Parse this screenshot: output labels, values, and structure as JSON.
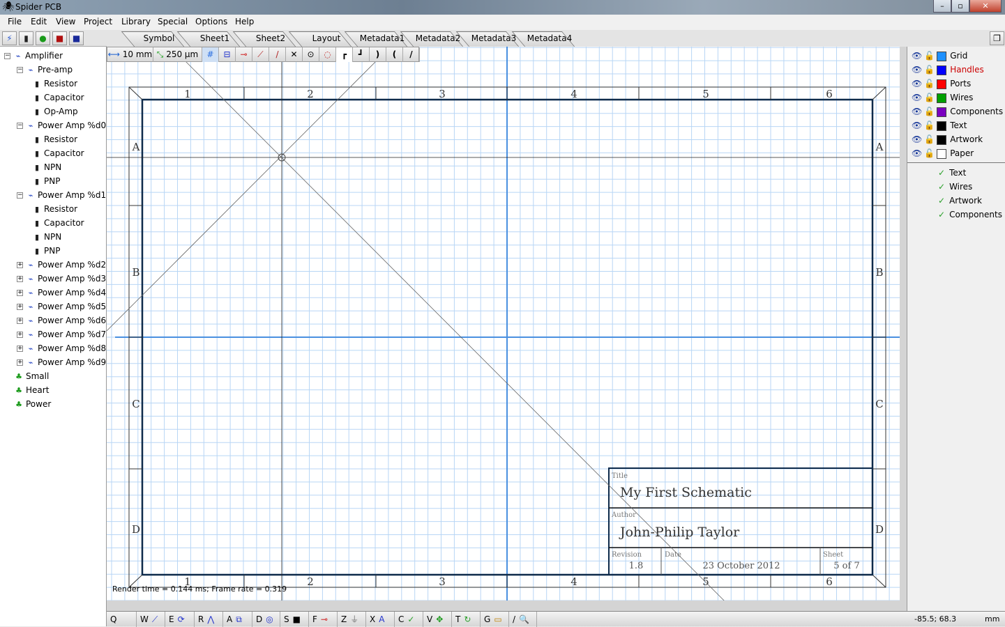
{
  "window": {
    "title": "Spider PCB",
    "minimize": "–",
    "maximize": "▫",
    "close": "✕"
  },
  "menu": [
    "File",
    "Edit",
    "View",
    "Project",
    "Library",
    "Special",
    "Options",
    "Help"
  ],
  "main_toolbar": [
    {
      "icon": "new-project-icon",
      "glyph": "⚡"
    },
    {
      "icon": "component-icon",
      "glyph": "▮"
    },
    {
      "icon": "add-icon",
      "glyph": "●"
    },
    {
      "icon": "save-icon",
      "glyph": "■"
    },
    {
      "icon": "save-all-icon",
      "glyph": "■"
    }
  ],
  "tabs": [
    "Symbol",
    "Sheet1",
    "Sheet2",
    "Layout",
    "Metadata1",
    "Metadata2",
    "Metadata3",
    "Metadata4"
  ],
  "draw_toolbar": {
    "grid_size": "10 mm",
    "line_width": "250 µm"
  },
  "tree": [
    {
      "label": "Amplifier",
      "level": 0,
      "type": "schematic",
      "exp": "−"
    },
    {
      "label": "Pre-amp",
      "level": 1,
      "type": "schematic",
      "exp": "−"
    },
    {
      "label": "Resistor",
      "level": 2,
      "type": "component"
    },
    {
      "label": "Capacitor",
      "level": 2,
      "type": "component"
    },
    {
      "label": "Op-Amp",
      "level": 2,
      "type": "component"
    },
    {
      "label": "Power Amp %d0",
      "level": 1,
      "type": "schematic",
      "exp": "−"
    },
    {
      "label": "Resistor",
      "level": 2,
      "type": "component"
    },
    {
      "label": "Capacitor",
      "level": 2,
      "type": "component"
    },
    {
      "label": "NPN",
      "level": 2,
      "type": "component"
    },
    {
      "label": "PNP",
      "level": 2,
      "type": "component"
    },
    {
      "label": "Power Amp %d1",
      "level": 1,
      "type": "schematic",
      "exp": "−"
    },
    {
      "label": "Resistor",
      "level": 2,
      "type": "component"
    },
    {
      "label": "Capacitor",
      "level": 2,
      "type": "component"
    },
    {
      "label": "NPN",
      "level": 2,
      "type": "component"
    },
    {
      "label": "PNP",
      "level": 2,
      "type": "component"
    },
    {
      "label": "Power Amp %d2",
      "level": 1,
      "type": "schematic",
      "exp": "+"
    },
    {
      "label": "Power Amp %d3",
      "level": 1,
      "type": "schematic",
      "exp": "+"
    },
    {
      "label": "Power Amp %d4",
      "level": 1,
      "type": "schematic",
      "exp": "+"
    },
    {
      "label": "Power Amp %d5",
      "level": 1,
      "type": "schematic",
      "exp": "+"
    },
    {
      "label": "Power Amp %d6",
      "level": 1,
      "type": "schematic",
      "exp": "+"
    },
    {
      "label": "Power Amp %d7",
      "level": 1,
      "type": "schematic",
      "exp": "+"
    },
    {
      "label": "Power Amp %d8",
      "level": 1,
      "type": "schematic",
      "exp": "+"
    },
    {
      "label": "Power Amp %d9",
      "level": 1,
      "type": "schematic",
      "exp": "+"
    },
    {
      "label": "Small",
      "level": 0,
      "type": "project"
    },
    {
      "label": "Heart",
      "level": 0,
      "type": "project"
    },
    {
      "label": "Power",
      "level": 0,
      "type": "project"
    }
  ],
  "layers": [
    {
      "name": "Grid",
      "color": "#1e90ff",
      "visible": true,
      "locked": false
    },
    {
      "name": "Handles",
      "color": "#0000ff",
      "visible": true,
      "locked": false,
      "highlight": "#cc0000"
    },
    {
      "name": "Ports",
      "color": "#ff0000",
      "visible": true,
      "locked": false
    },
    {
      "name": "Wires",
      "color": "#00a000",
      "visible": true,
      "locked": false
    },
    {
      "name": "Components",
      "color": "#7a00c0",
      "visible": true,
      "locked": false
    },
    {
      "name": "Text",
      "color": "#000000",
      "visible": true,
      "locked": false
    },
    {
      "name": "Artwork",
      "color": "#000000",
      "visible": true,
      "locked": false
    },
    {
      "name": "Paper",
      "color": "#ffffff",
      "visible": true,
      "locked": false
    }
  ],
  "checks": [
    "Text",
    "Wires",
    "Artwork",
    "Components"
  ],
  "sheet": {
    "columns": [
      "1",
      "2",
      "3",
      "4",
      "5",
      "6"
    ],
    "rows": [
      "A",
      "B",
      "C",
      "D"
    ],
    "title_label": "Title",
    "title": "My First Schematic",
    "author_label": "Author",
    "author": "John-Philip Taylor",
    "revision_label": "Revision",
    "revision": "1.8",
    "date_label": "Date",
    "date": "23 October 2012",
    "sheet_label": "Sheet",
    "sheet": "5 of 7"
  },
  "render_info": "Render time = 0.144 ms; Frame rate = 0.319",
  "bottom_toolbar": [
    {
      "key": "Q",
      "glyph": ""
    },
    {
      "key": "W",
      "glyph": "⟋"
    },
    {
      "key": "E",
      "glyph": "⟳"
    },
    {
      "key": "R",
      "glyph": "⋀"
    },
    {
      "key": "A",
      "glyph": "⧉"
    },
    {
      "key": "D",
      "glyph": "◎"
    },
    {
      "key": "S",
      "glyph": "■"
    },
    {
      "key": "F",
      "glyph": "⊸"
    },
    {
      "key": "Z",
      "glyph": "⏚"
    },
    {
      "key": "X",
      "glyph": "A"
    },
    {
      "key": "C",
      "glyph": "✓"
    },
    {
      "key": "V",
      "glyph": "✥"
    },
    {
      "key": "T",
      "glyph": "↻"
    },
    {
      "key": "G",
      "glyph": "▭"
    },
    {
      "key": "/",
      "glyph": "🔍"
    }
  ],
  "status": {
    "coords": "-85.5; 68.3",
    "units": "mm"
  }
}
